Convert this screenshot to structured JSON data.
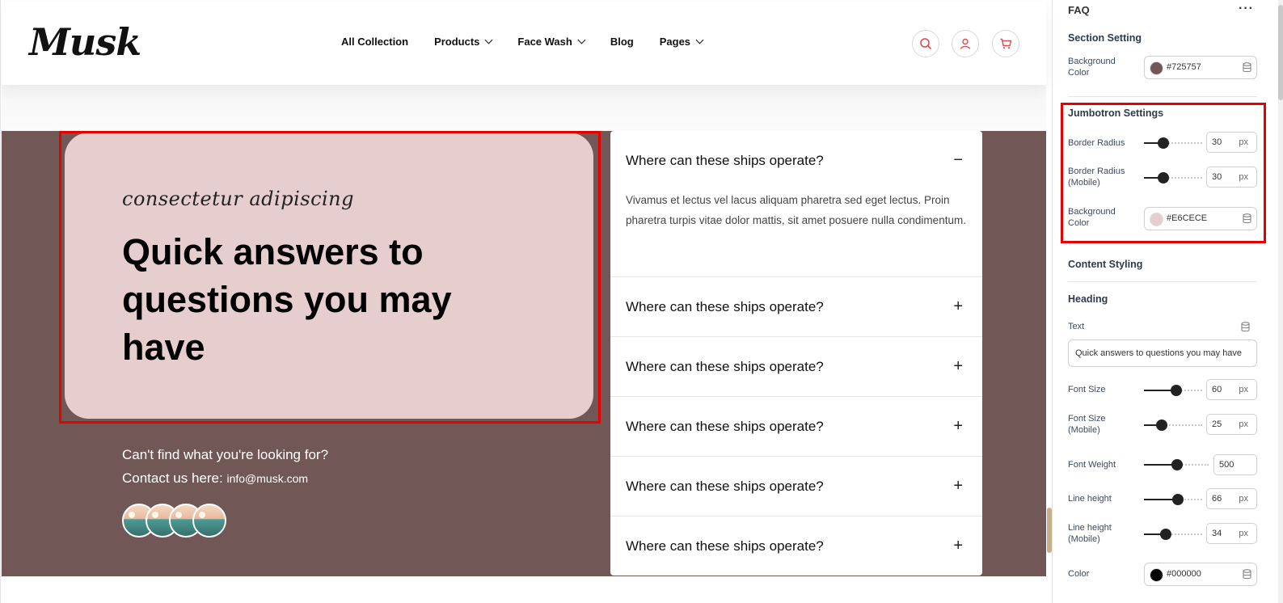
{
  "header": {
    "logo": "Musk",
    "nav": [
      {
        "label": "All Collection",
        "dropdown": false
      },
      {
        "label": "Products",
        "dropdown": true
      },
      {
        "label": "Face Wash",
        "dropdown": true
      },
      {
        "label": "Blog",
        "dropdown": false
      },
      {
        "label": "Pages",
        "dropdown": true
      }
    ],
    "icons": [
      "search-icon",
      "user-icon",
      "cart-icon"
    ]
  },
  "jumbotron": {
    "subheading": "consectetur adipiscing",
    "heading": "Quick answers to questions you may have"
  },
  "contact": {
    "line1": "Can't find what you're looking for?",
    "line2_label": "Contact us here:",
    "email": "info@musk.com"
  },
  "faq": [
    {
      "question": "Where can these ships operate?",
      "expanded": true,
      "answer": "Vivamus et lectus vel lacus aliquam pharetra sed eget lectus. Proin pharetra turpis vitae dolor mattis, sit amet posuere nulla condimentum."
    },
    {
      "question": "Where can these ships operate?",
      "expanded": false
    },
    {
      "question": "Where can these ships operate?",
      "expanded": false
    },
    {
      "question": "Where can these ships operate?",
      "expanded": false
    },
    {
      "question": "Where can these ships operate?",
      "expanded": false
    },
    {
      "question": "Where can these ships operate?",
      "expanded": false
    }
  ],
  "signs": {
    "expanded": "−",
    "collapsed": "+"
  },
  "panel": {
    "title": "FAQ",
    "more": "···",
    "section_setting": {
      "title": "Section Setting",
      "background_label": "Background Color",
      "background_value": "#725757"
    },
    "jumbotron_settings": {
      "title": "Jumbotron Settings",
      "border_radius_label": "Border Radius",
      "border_radius_value": "30",
      "border_radius_mobile_label": "Border Radius (Mobile)",
      "border_radius_mobile_value": "30",
      "background_label": "Background Color",
      "background_value": "#E6CECE"
    },
    "content_styling": {
      "title": "Content Styling"
    },
    "heading": {
      "title": "Heading",
      "text_label": "Text",
      "text_value": "Quick answers to questions you may have",
      "font_size_label": "Font Size",
      "font_size_value": "60",
      "font_size_mobile_label": "Font Size (Mobile)",
      "font_size_mobile_value": "25",
      "font_weight_label": "Font Weight",
      "font_weight_value": "500",
      "line_height_label": "Line height",
      "line_height_value": "66",
      "line_height_mobile_label": "Line height (Mobile)",
      "line_height_mobile_value": "34",
      "color_label": "Color",
      "color_value": "#000000"
    },
    "unit": "px"
  },
  "colors": {
    "section_bg": "#725757",
    "jumbo_bg": "#E6CECE",
    "heading_color": "#000000",
    "highlight": "#e60000",
    "icon_accent": "#d94d4d"
  }
}
